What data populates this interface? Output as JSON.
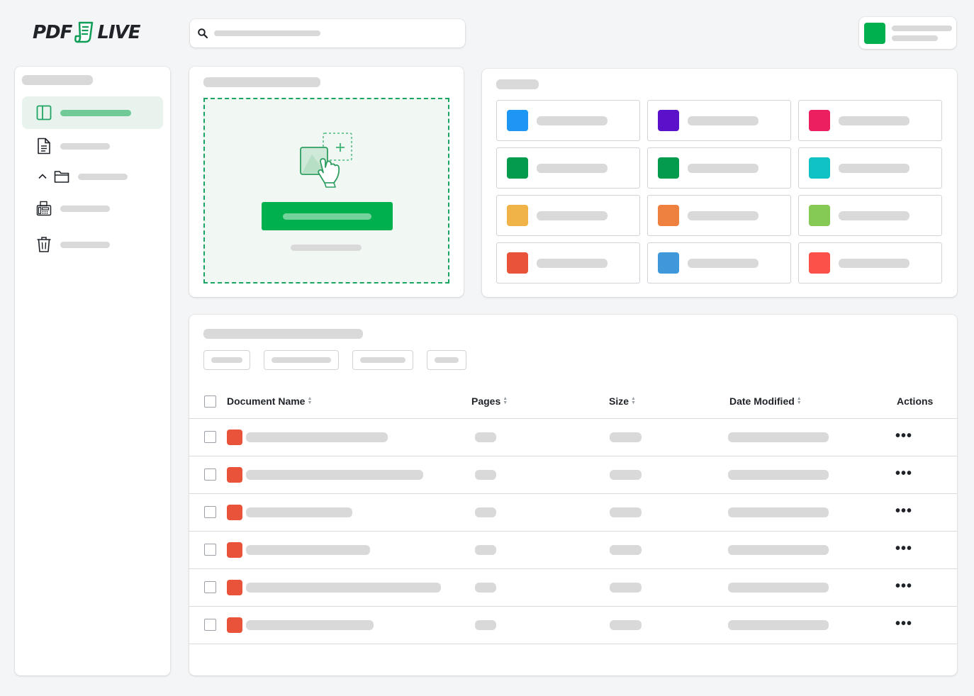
{
  "logo": {
    "left_text": "PDF",
    "right_text": "LIVE"
  },
  "colors": {
    "brand_green": "#00b04f",
    "active_nav_bg": "#e7f3ec",
    "pdf_icon": "#e9533a",
    "placeholder": "#d9d9d9"
  },
  "icons": {
    "search": "search-icon",
    "sidebar_items": [
      "layout-panel-icon",
      "document-icon",
      "folder-icon",
      "fax-icon",
      "trash-icon"
    ],
    "upload": "upload-hand-icon",
    "row_action": "more-icon"
  },
  "tools": {
    "colors": [
      "#1e96f3",
      "#5a11c9",
      "#ec1f61",
      "#049b4d",
      "#049b4d",
      "#10c2c4",
      "#f0b347",
      "#ee8040",
      "#85ca54",
      "#e9533a",
      "#3f98da",
      "#fc5148"
    ]
  },
  "table": {
    "columns": {
      "name": "Document Name",
      "pages": "Pages",
      "size": "Size",
      "date": "Date Modified",
      "actions": "Actions"
    },
    "row_action_label": "•••",
    "row_count": 6
  }
}
